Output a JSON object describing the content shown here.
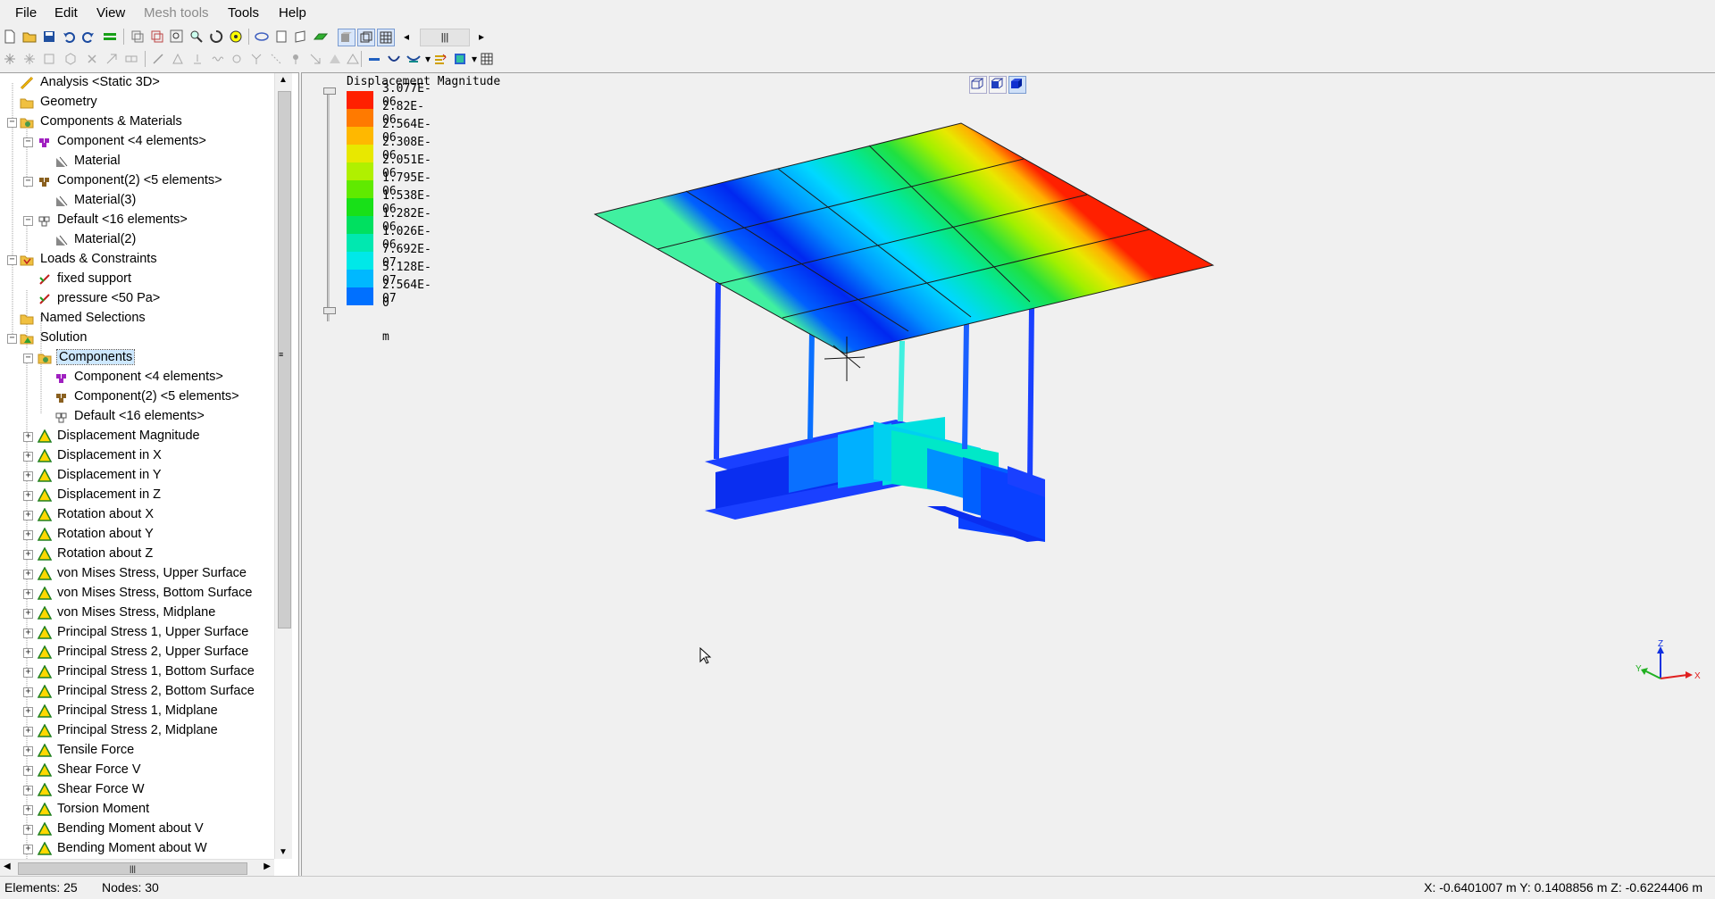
{
  "menu": {
    "items": [
      "File",
      "Edit",
      "View",
      "Mesh tools",
      "Tools",
      "Help"
    ],
    "disabled": [
      "Mesh tools"
    ]
  },
  "tree": {
    "analysis": "Analysis <Static 3D>",
    "geometry": "Geometry",
    "components_materials": "Components & Materials",
    "component1": "Component <4 elements>",
    "material1": "Material",
    "component2": "Component(2) <5 elements>",
    "material3": "Material(3)",
    "default_comp": "Default <16 elements>",
    "material2": "Material(2)",
    "loads": "Loads & Constraints",
    "fixed_support": "fixed support",
    "pressure": "pressure <50 Pa>",
    "named_selections": "Named Selections",
    "solution": "Solution",
    "sol_components": "Components",
    "sol_component1": "Component <4 elements>",
    "sol_component2": "Component(2) <5 elements>",
    "sol_default": "Default <16 elements>",
    "results": [
      "Displacement Magnitude",
      "Displacement in X",
      "Displacement in Y",
      "Displacement in Z",
      "Rotation about X",
      "Rotation about Y",
      "Rotation about Z",
      "von Mises Stress, Upper Surface",
      "von Mises Stress, Bottom Surface",
      "von Mises Stress, Midplane",
      "Principal Stress 1, Upper Surface",
      "Principal Stress 2, Upper Surface",
      "Principal Stress 1, Bottom Surface",
      "Principal Stress 2, Bottom Surface",
      "Principal Stress 1, Midplane",
      "Principal Stress 2, Midplane",
      "Tensile Force",
      "Shear Force V",
      "Shear Force W",
      "Torsion Moment",
      "Bending Moment about V",
      "Bending Moment about W"
    ]
  },
  "legend": {
    "title": "Displacement Magnitude",
    "values": [
      "3.077E-06",
      "2.82E-06",
      "2.564E-06",
      "2.308E-06",
      "2.051E-06",
      "1.795E-06",
      "1.538E-06",
      "1.282E-06",
      "1.026E-06",
      "7.692E-07",
      "5.128E-07",
      "2.564E-07",
      "0"
    ],
    "colors": [
      "#ff2000",
      "#ff7a00",
      "#ffb800",
      "#e8e800",
      "#b0f000",
      "#60ea00",
      "#18e018",
      "#00e060",
      "#00e8b0",
      "#00e8e8",
      "#00b8ff",
      "#0070ff",
      "#0020ff"
    ],
    "unit": "m"
  },
  "axes": {
    "z": "Z",
    "y": "Y",
    "x": "X"
  },
  "status": {
    "elements": "Elements:  25",
    "nodes": "Nodes: 30",
    "coords": "X: -0.6401007 m Y: 0.1408856 m Z: -0.6224406 m"
  }
}
